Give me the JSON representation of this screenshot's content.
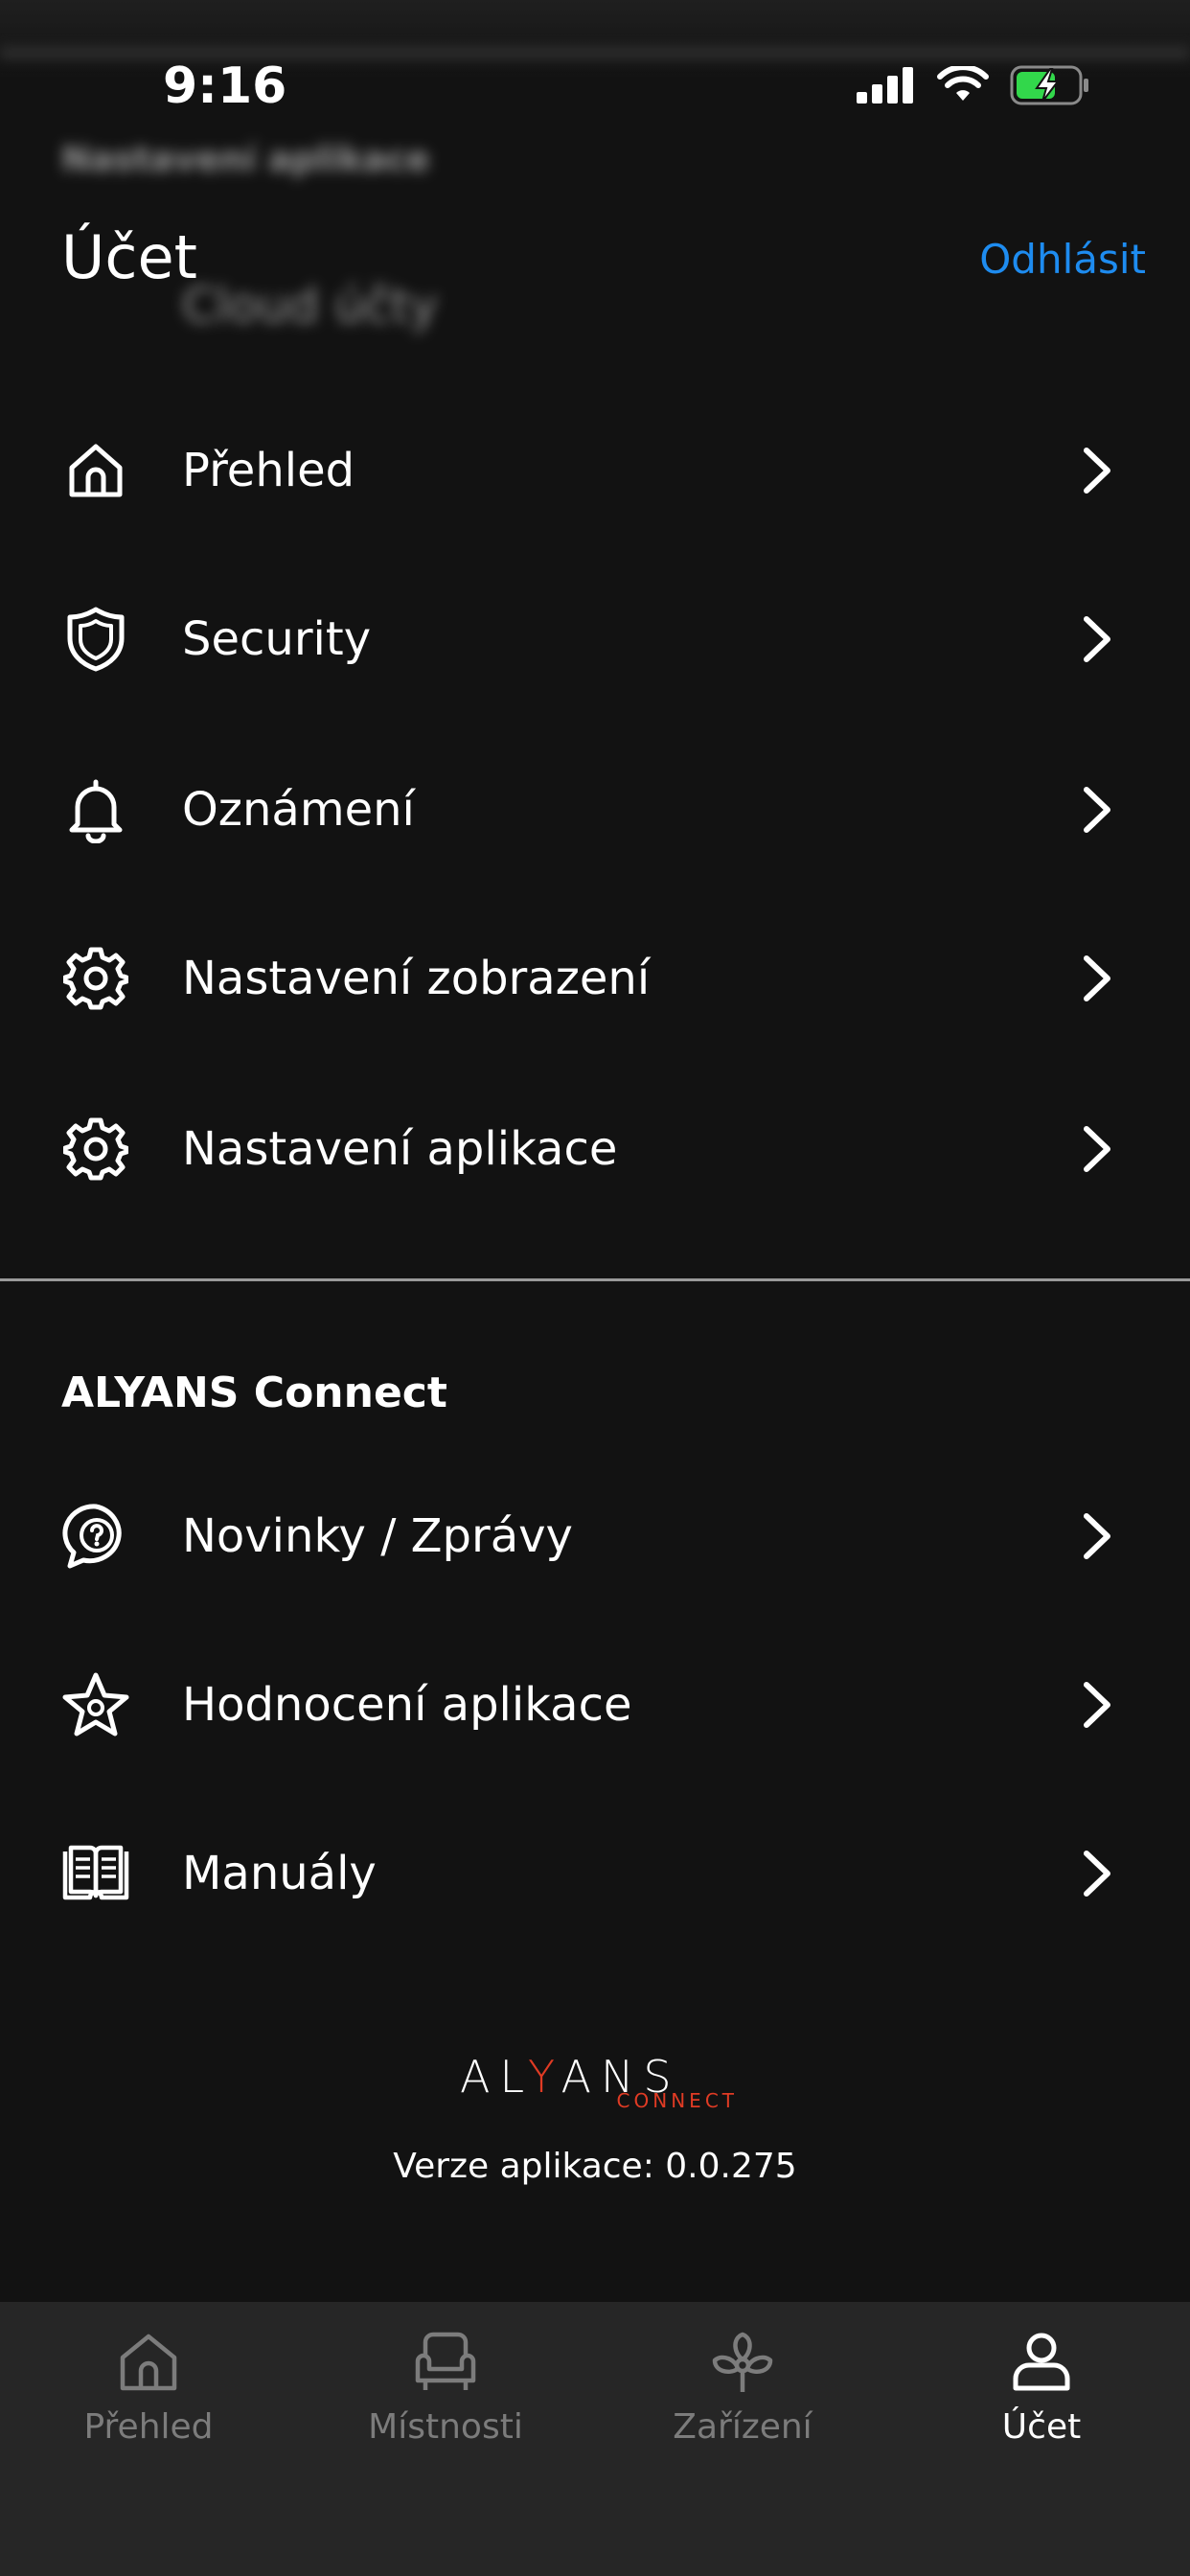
{
  "status_bar": {
    "time": "9:16"
  },
  "header": {
    "title": "Účet",
    "logout_label": "Odhlásit"
  },
  "ghost": {
    "line1": "Nastavení aplikace",
    "line2": "Cloud účty"
  },
  "menu": [
    {
      "label": "Přehled",
      "icon": "home-icon"
    },
    {
      "label": "Security",
      "icon": "shield-icon"
    },
    {
      "label": "Oznámení",
      "icon": "bell-icon"
    },
    {
      "label": "Nastavení zobrazení",
      "icon": "gear-icon"
    },
    {
      "label": "Nastavení aplikace",
      "icon": "gear-icon"
    }
  ],
  "section": {
    "title": "ALYANS Connect",
    "items": [
      {
        "label": "Novinky / Zprávy",
        "icon": "chat-question-icon"
      },
      {
        "label": "Hodnocení aplikace",
        "icon": "star-icon"
      },
      {
        "label": "Manuály",
        "icon": "book-icon"
      }
    ]
  },
  "logo": {
    "word_a": "AL",
    "word_y": "Y",
    "word_b": "ANS",
    "sub": "CONNECT"
  },
  "version": "Verze aplikace: 0.0.275",
  "tabs": [
    {
      "label": "Přehled",
      "icon": "home-icon",
      "active": false
    },
    {
      "label": "Místnosti",
      "icon": "armchair-icon",
      "active": false
    },
    {
      "label": "Zařízení",
      "icon": "fan-icon",
      "active": false
    },
    {
      "label": "Účet",
      "icon": "user-icon",
      "active": true
    }
  ],
  "colors": {
    "background": "#121212",
    "tabbar": "#262626",
    "accent": "#1e8cf0",
    "brand_red": "#e03b24",
    "inactive": "#7c7c7c"
  }
}
